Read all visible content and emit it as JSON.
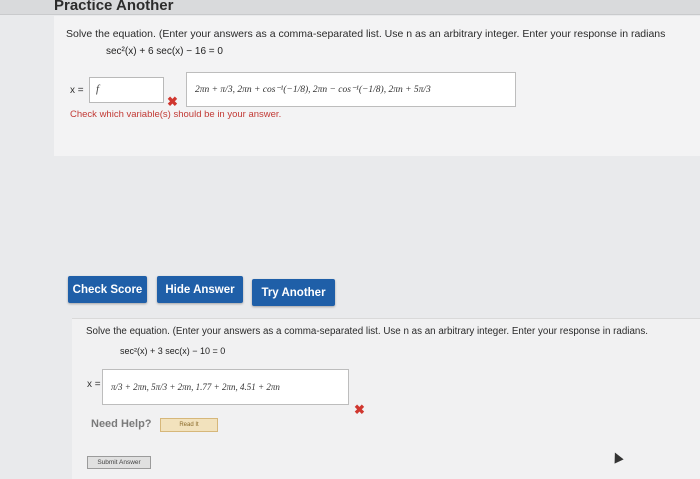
{
  "page_title": "Practice Another",
  "problem1": {
    "instruction": "Solve the equation. (Enter your answers as a comma-separated list. Use n as an arbitrary integer. Enter your response in radians",
    "equation": "sec²(x) + 6 sec(x) − 16 = 0",
    "x_label": "x =",
    "input_value": "f",
    "answer": "2πn + π/3, 2πn + cos⁻¹(−1/8), 2πn − cos⁻¹(−1/8), 2πn + 5π/3",
    "hint": "Check which variable(s) should be in your answer."
  },
  "buttons": {
    "check_score": "Check Score",
    "hide_answer": "Hide Answer",
    "try_another": "Try Another"
  },
  "problem2": {
    "instruction": "Solve the equation. (Enter your answers as a comma-separated list. Use n as an arbitrary integer. Enter your response in radians.",
    "equation": "sec²(x) + 3 sec(x) − 10 = 0",
    "x_label": "x =",
    "answer": "π/3 + 2πn, 5π/3 + 2πn, 1.77 + 2πn, 4.51 + 2πn"
  },
  "help": {
    "label": "Need Help?",
    "read_it": "Read It"
  },
  "submit_label": "Submit Answer",
  "colors": {
    "button_blue": "#1f5fa8",
    "error_red": "#d0372f"
  }
}
